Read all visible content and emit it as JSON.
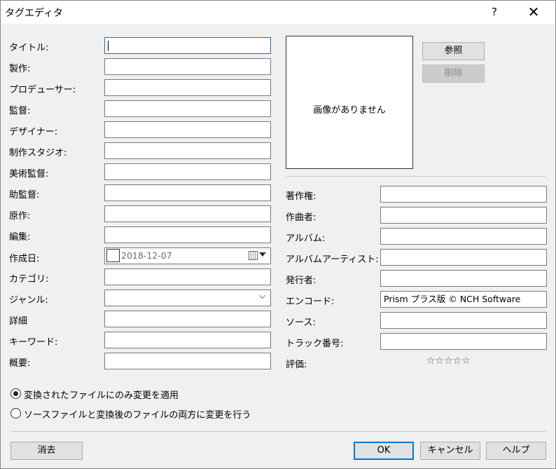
{
  "window": {
    "title": "タグエディタ",
    "help": "?",
    "close": "✕"
  },
  "left_fields": [
    {
      "label": "タイトル:",
      "value": ""
    },
    {
      "label": "製作:",
      "value": ""
    },
    {
      "label": "プロデューサー:",
      "value": ""
    },
    {
      "label": "監督:",
      "value": ""
    },
    {
      "label": "デザイナー:",
      "value": ""
    },
    {
      "label": "制作スタジオ:",
      "value": ""
    },
    {
      "label": "美術監督:",
      "value": ""
    },
    {
      "label": "助監督:",
      "value": ""
    },
    {
      "label": "原作:",
      "value": ""
    },
    {
      "label": "編集:",
      "value": ""
    },
    {
      "label": "作成日:",
      "value": "2018-12-07"
    },
    {
      "label": "カテゴリ:",
      "value": ""
    },
    {
      "label": "ジャンル:",
      "value": ""
    },
    {
      "label": "詳細",
      "value": ""
    },
    {
      "label": "キーワード:",
      "value": ""
    },
    {
      "label": "概要:",
      "value": ""
    }
  ],
  "image": {
    "placeholder": "画像がありません",
    "browse": "参照",
    "delete": "削除"
  },
  "right_fields": [
    {
      "label": "著作権:",
      "value": ""
    },
    {
      "label": "作曲者:",
      "value": ""
    },
    {
      "label": "アルバム:",
      "value": ""
    },
    {
      "label": "アルバムアーティスト:",
      "value": ""
    },
    {
      "label": "発行者:",
      "value": ""
    },
    {
      "label": "エンコード:",
      "value": "Prism プラス版 © NCH Software"
    },
    {
      "label": "ソース:",
      "value": ""
    },
    {
      "label": "トラック番号:",
      "value": ""
    }
  ],
  "rating": {
    "label": "評価:",
    "stars": "☆☆☆☆☆",
    "value": 0
  },
  "options": {
    "apply_converted": "変換されたファイルにのみ変更を適用",
    "apply_both": "ソースファイルと変換後のファイルの両方に変更を行う",
    "selected": "apply_converted"
  },
  "buttons": {
    "clear": "消去",
    "ok": "OK",
    "cancel": "キャンセル",
    "help": "ヘルプ"
  }
}
